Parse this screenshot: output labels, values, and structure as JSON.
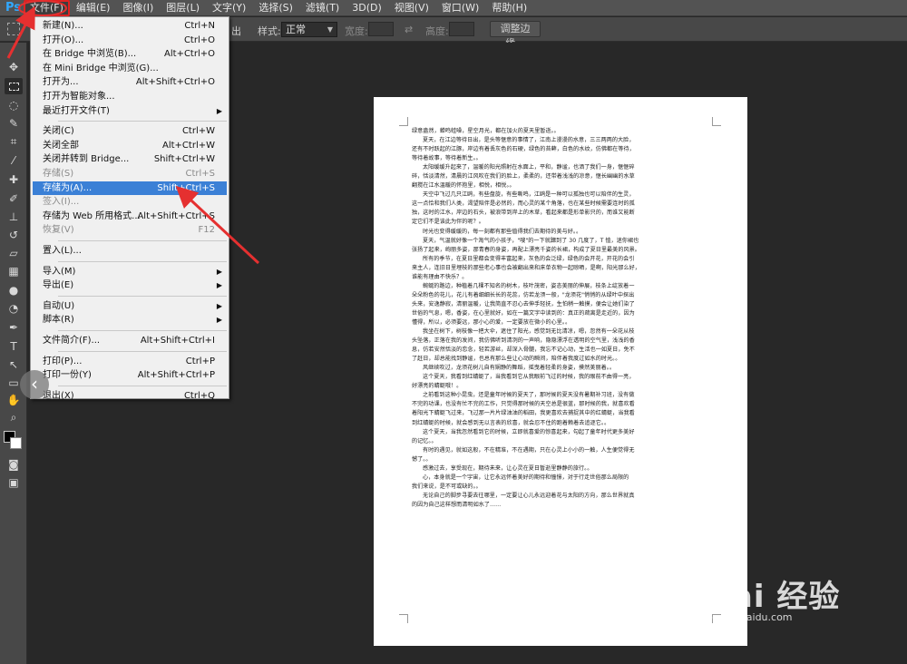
{
  "app": {
    "logo": "Ps"
  },
  "menubar": {
    "items": [
      "文件(F)",
      "编辑(E)",
      "图像(I)",
      "图层(L)",
      "文字(Y)",
      "选择(S)",
      "滤镜(T)",
      "3D(D)",
      "视图(V)",
      "窗口(W)",
      "帮助(H)"
    ],
    "active": "文件(F)"
  },
  "options_bar": {
    "style_label": "样式:",
    "style_value": "正常",
    "width_label": "宽度:",
    "height_label": "高度:",
    "refine_button": "调整边缘...",
    "partial_label": "出"
  },
  "file_menu": {
    "items": [
      {
        "label": "新建(N)...",
        "shortcut": "Ctrl+N"
      },
      {
        "label": "打开(O)...",
        "shortcut": "Ctrl+O"
      },
      {
        "label": "在 Bridge 中浏览(B)...",
        "shortcut": "Alt+Ctrl+O"
      },
      {
        "label": "在 Mini Bridge 中浏览(G)...",
        "shortcut": ""
      },
      {
        "label": "打开为...",
        "shortcut": "Alt+Shift+Ctrl+O"
      },
      {
        "label": "打开为智能对象...",
        "shortcut": ""
      },
      {
        "label": "最近打开文件(T)",
        "shortcut": "",
        "submenu": true
      },
      {
        "label": "关闭(C)",
        "shortcut": "Ctrl+W"
      },
      {
        "label": "关闭全部",
        "shortcut": "Alt+Ctrl+W"
      },
      {
        "label": "关闭并转到 Bridge...",
        "shortcut": "Shift+Ctrl+W"
      },
      {
        "label": "存储(S)",
        "shortcut": "Ctrl+S",
        "disabled": true
      },
      {
        "label": "存储为(A)...",
        "shortcut": "Shift+Ctrl+S",
        "highlighted": true
      },
      {
        "label": "签入(I)...",
        "shortcut": "",
        "disabled": true
      },
      {
        "label": "存储为 Web 所用格式...",
        "shortcut": "Alt+Shift+Ctrl+S"
      },
      {
        "label": "恢复(V)",
        "shortcut": "F12",
        "disabled": true
      },
      {
        "label": "置入(L)...",
        "shortcut": ""
      },
      {
        "label": "导入(M)",
        "shortcut": "",
        "submenu": true
      },
      {
        "label": "导出(E)",
        "shortcut": "",
        "submenu": true
      },
      {
        "label": "自动(U)",
        "shortcut": "",
        "submenu": true
      },
      {
        "label": "脚本(R)",
        "shortcut": "",
        "submenu": true
      },
      {
        "label": "文件简介(F)...",
        "shortcut": "Alt+Shift+Ctrl+I"
      },
      {
        "label": "打印(P)...",
        "shortcut": "Ctrl+P"
      },
      {
        "label": "打印一份(Y)",
        "shortcut": "Alt+Shift+Ctrl+P"
      },
      {
        "label": "退出(X)",
        "shortcut": "Ctrl+Q"
      }
    ]
  },
  "document": {
    "lines": [
      {
        "t": "绿意盎然，蝉鸣蛙噪，星空月光，都在加火的夏天里暂逝。。",
        "i": false
      },
      {
        "t": "夏天，在江边等待日出，是头等惬意的事情了，江南上漫漫的水意，三三两两的大脸，",
        "i": true
      },
      {
        "t": "还有不时跃起的江豚，岸边有着丢灰色的石硬，绿色的苔藓，白色的水纹，仿佛都在等待，",
        "i": false
      },
      {
        "t": "等待着故事，等待着新生。。",
        "i": false
      },
      {
        "t": "太阳缓缓升起来了，温暖的阳光照射在水面上，平和，静谧，也洒了我们一身，惬惬碎",
        "i": true
      },
      {
        "t": "碎，恬淡清然，清晨的江风吹在我们的脸上，柔柔的，还带着浅浅的凉意，惬长幽幽的水草",
        "i": false
      },
      {
        "t": "翻搅在江水温暖的怀抱里，相悦，相悦。。",
        "i": false
      },
      {
        "t": "天空中飞过几只江鸥，有些盘旋，有些嘶鸣，江鸥是一种可以孤独也可以陪伴的生灵，",
        "i": true
      },
      {
        "t": "这一点恰和我们人类，渴望陪伴是必然的，而心灵的某个角落，也在某些时候需要连时的孤",
        "i": false
      },
      {
        "t": "独，这时的江水，岸边的石头，被浪带到岸上的木草，看起来都是形单影只的，而谁又能断",
        "i": false
      },
      {
        "t": "定它们不是该此为伴的呢？。",
        "i": false
      },
      {
        "t": "时光也变得缓缓的，每一刻都有那些值得我们去期待的美与好。。",
        "i": true
      },
      {
        "t": "夏天，气温就好像一个淘气的小孩子，\"嗖\"的一下就蹿到了 30 几度了，T 恤，迷你裙也",
        "i": true
      },
      {
        "t": "张扬了起来，绚丽多姿，那青春的身姿，再配上漂亮千姿的长裙，构成了夏日里最美的风景。",
        "i": false
      },
      {
        "t": "所有的季节，在夏日里都会变得丰富起来，灰色的会泛绿，绿色的会开花，开花的会引",
        "i": true
      },
      {
        "t": "来主人，连旧日里埋枝的那些老心事也会被翻出来和床单衣物一起晾晒，是啊，阳光那么好，",
        "i": false
      },
      {
        "t": "谁能有理由不快乐？。",
        "i": false
      },
      {
        "t": "蜿蜒的路边，种植着几棵不知名的树木，枝叶茂密，姿态美丽的伸展，枝条上绽放着一",
        "i": true
      },
      {
        "t": "朵朵粉色的花儿，花儿有着细细长长的花蕊，仿若龙须一般，\"龙须花\"悄悄的从绿叶中探出",
        "i": false
      },
      {
        "t": "头来，安逸静寂，清丽温暖，让我简直不忍心去伸手轻抚，生怕稍一触摸，便会让她们染了",
        "i": false
      },
      {
        "t": "世俗的气息，嗯，香姿，在心里就好，如在一篇文字中读到的：真正的疏离是走近的，因为",
        "i": false
      },
      {
        "t": "懂得，所以，必须要远，那小心的爱，一定要放在微小的心里。。",
        "i": false
      },
      {
        "t": "我坐在树下，树枝像一把大伞，遮住了阳光，感觉到无比清凉，嗯，忽然有一朵花从枝",
        "i": true
      },
      {
        "t": "头坠落，正落在我的发间，我仿佛听到清冽的一声响，隐隐漂浮在透明的空气里，浅浅的香",
        "i": false
      },
      {
        "t": "息，仿若安然恬淡的恋念，轻若游丝，却深入骨髓，我忘不记心动，生活也一如夏日，免不",
        "i": false
      },
      {
        "t": "了赶日，却总能找到静谧，也总有那么些让心动的瞬间，陪伴着我度过如水的时光。。",
        "i": false
      },
      {
        "t": "风继续吹过，龙须花树儿自有娴静的舞蹈，摇曳着轻柔的身姿，摸然美丽着。。",
        "i": true
      },
      {
        "t": "这个夏天，我看到红蜻蜓了，当我看到它从我眼前飞过的时候，我的眼前不由得一亮，",
        "i": true
      },
      {
        "t": "好漂亮的蜻蜓哦！。",
        "i": false
      },
      {
        "t": "之前看到这种小昆虫，还是童年时候的夏天了，那时候的夏天没有暑期补习班，没有做",
        "i": true
      },
      {
        "t": "不完的功课，也没有忙不完的工作，只觉得那时候的天空总是很蓝，那时候的我，就喜欢看",
        "i": false
      },
      {
        "t": "着阳光下蜻蜓飞过来，飞过那一片片绿油油的稻田，我更喜欢去捕捉其中的红蜻蜓，当我看",
        "i": false
      },
      {
        "t": "到红蜻蜓的时候，就会感到无以言表的欣喜，就会忍不住的跑着赖着去追逐它。。",
        "i": false
      },
      {
        "t": "这个夏天，当我忽然看到它的时候，立即就喜爱的惊喜起来，勾起了童年时代更多美好",
        "i": true
      },
      {
        "t": "的记忆。。",
        "i": false
      },
      {
        "t": "有时的遇见，就如这般，不在精准，不在遇期，只在心灵上小小的一触，人生便觉得无",
        "i": true
      },
      {
        "t": "憾了。。",
        "i": false
      },
      {
        "t": "感激过去，享受现在，期待未来，让心灵在夏日暂逝里静静的旅行。。",
        "i": true
      },
      {
        "t": "心，本身就是一个宇宙，让它永远怀着美好的期待和憧憬，对于行走世俗那么局限的",
        "i": true
      },
      {
        "t": "我们来说，是不可或缺的。。",
        "i": false
      },
      {
        "t": "无论自己的脚步寻要去往哪里，一定要让心儿永远迎着花与太阳的方向，那么世界就真",
        "i": true
      },
      {
        "t": "的因为自己这样想而清明如水了……",
        "i": false
      }
    ]
  },
  "watermark": {
    "brand": "Bai 经验",
    "url": "jingyan.baidu.com"
  },
  "colors": {
    "highlight": "#3b80d6",
    "arrow": "#e53030",
    "menu_bg": "#f0f0f0",
    "canvas_bg": "#282828",
    "ps_blue": "#31a8ff"
  },
  "icons": [
    "move-tool-icon",
    "marquee-tool-icon",
    "lasso-tool-icon",
    "quick-select-icon",
    "crop-tool-icon",
    "eyedropper-icon",
    "spot-heal-icon",
    "brush-tool-icon",
    "clone-stamp-icon",
    "history-brush-icon",
    "eraser-icon",
    "gradient-icon",
    "blur-icon",
    "dodge-icon",
    "pen-tool-icon",
    "type-tool-icon",
    "path-select-icon",
    "shape-tool-icon",
    "hand-tool-icon",
    "zoom-tool-icon"
  ]
}
